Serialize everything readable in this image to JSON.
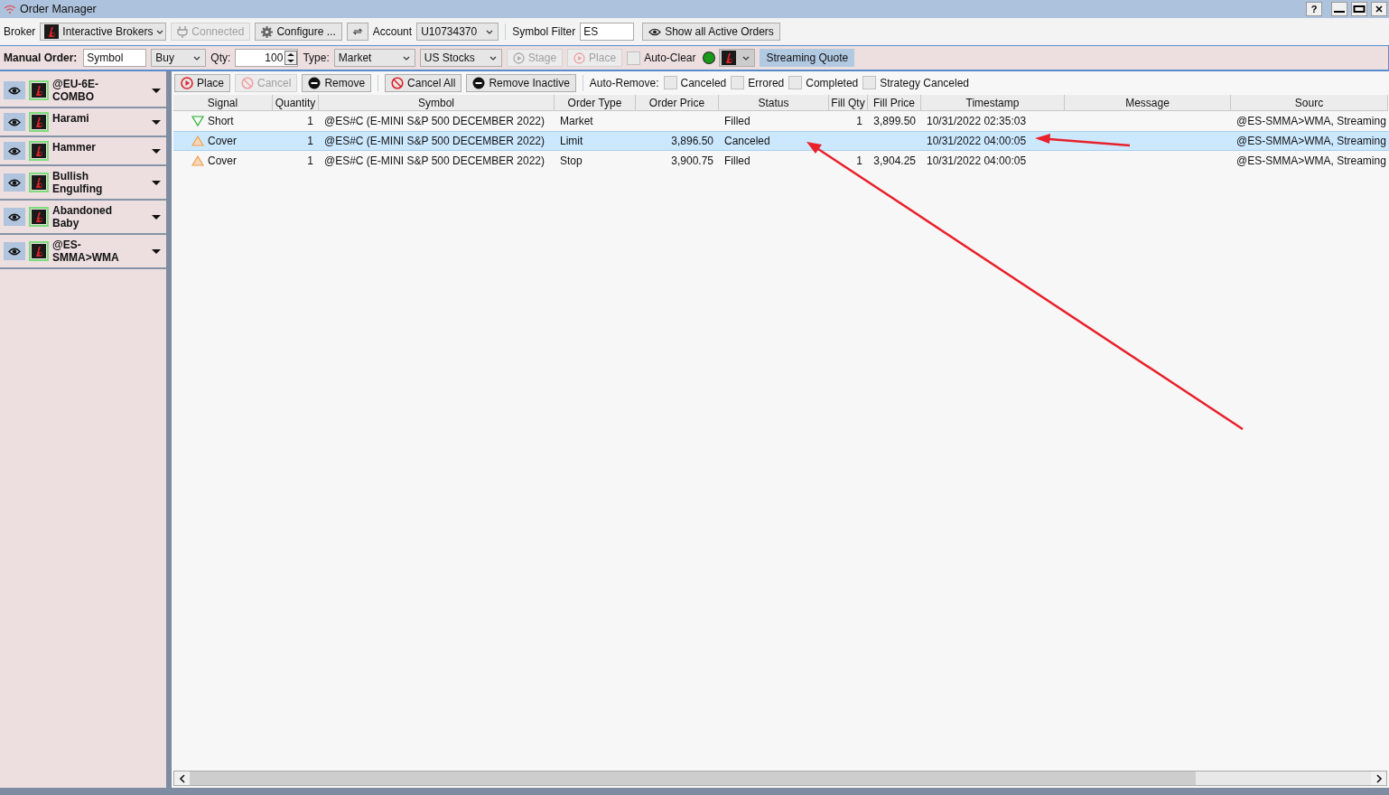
{
  "window": {
    "title": "Order Manager",
    "help": "?"
  },
  "connection_bar": {
    "broker_label": "Broker",
    "broker": "Interactive Brokers",
    "connect_button": {
      "label": "Connected",
      "disabled": true
    },
    "configure_button": "Configure ...",
    "account_label": "Account",
    "account": "U10734370",
    "symbol_filter_label": "Symbol Filter",
    "symbol_filter": "ES",
    "show_all_button": "Show all Active Orders"
  },
  "manual_order": {
    "label": "Manual Order:",
    "symbol_placeholder": "Symbol",
    "side": "Buy",
    "qty_label": "Qty:",
    "qty": "100",
    "type_label": "Type:",
    "type": "Market",
    "market": "US Stocks",
    "buttons": [
      {
        "label": "Stage",
        "disabled": true
      },
      {
        "label": "Place",
        "disabled": true
      }
    ],
    "auto_clear": {
      "label": "Auto-Clear",
      "checked": false
    },
    "quote_button": "Streaming Quote"
  },
  "strategies": [
    {
      "name": "@EU-6E-\nCOMBO"
    },
    {
      "name": "Harami"
    },
    {
      "name": "Hammer"
    },
    {
      "name": "Bullish\nEngulfing"
    },
    {
      "name": "Abandoned\nBaby"
    },
    {
      "name": "@ES-\nSMMA>WMA"
    }
  ],
  "order_toolbar": {
    "buttons": [
      {
        "label": "Place",
        "kind": "play",
        "disabled": false
      },
      {
        "label": "Cancel",
        "kind": "prohibit",
        "disabled": true
      },
      {
        "label": "Remove",
        "kind": "minus",
        "disabled": false
      },
      {
        "label": "Cancel All",
        "kind": "prohibit",
        "disabled": false
      },
      {
        "label": "Remove Inactive",
        "kind": "minus",
        "disabled": false
      }
    ],
    "auto_remove_label": "Auto-Remove:",
    "auto_remove": [
      {
        "label": "Canceled",
        "checked": false
      },
      {
        "label": "Errored",
        "checked": false
      },
      {
        "label": "Completed",
        "checked": false
      },
      {
        "label": "Strategy Canceled",
        "checked": false
      }
    ]
  },
  "table": {
    "columns": [
      "Signal",
      "Quantity",
      "Symbol",
      "Order Type",
      "Order Price",
      "Status",
      "Fill Qty",
      "Fill Price",
      "Timestamp",
      "Message",
      "Sourc"
    ],
    "rows": [
      {
        "kind": "short",
        "selected": false,
        "cells": [
          "Short",
          "1",
          "@ES#C (E-MINI S&P 500 DECEMBER 2022)",
          "Market",
          "",
          "Filled",
          "1",
          "3,899.50",
          "10/31/2022 02:35:03",
          "",
          "@ES-SMMA>WMA, Streaming"
        ]
      },
      {
        "kind": "cover",
        "selected": true,
        "cells": [
          "Cover",
          "1",
          "@ES#C (E-MINI S&P 500 DECEMBER 2022)",
          "Limit",
          "3,896.50",
          "Canceled",
          "",
          "",
          "10/31/2022 04:00:05",
          "",
          "@ES-SMMA>WMA, Streaming"
        ]
      },
      {
        "kind": "cover",
        "selected": false,
        "cells": [
          "Cover",
          "1",
          "@ES#C (E-MINI S&P 500 DECEMBER 2022)",
          "Stop",
          "3,900.75",
          "Filled",
          "1",
          "3,904.25",
          "10/31/2022 04:00:05",
          "",
          "@ES-SMMA>WMA, Streaming"
        ]
      }
    ]
  }
}
